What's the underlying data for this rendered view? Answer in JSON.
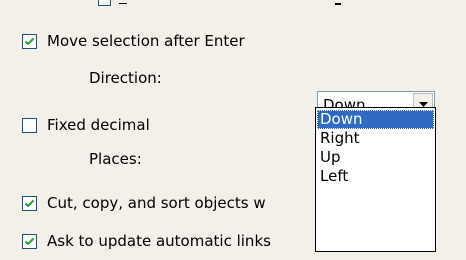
{
  "options": {
    "move_selection_after_enter": {
      "label": "Move selection after Enter",
      "checked": true
    },
    "direction": {
      "label": "Direction:",
      "value": "Down",
      "list": [
        "Down",
        "Right",
        "Up",
        "Left"
      ],
      "highlighted": "Down"
    },
    "fixed_decimal": {
      "label": "Fixed decimal",
      "checked": false
    },
    "places": {
      "label": "Places:"
    },
    "cut_copy_sort": {
      "label": "Cut, copy, and sort objects w",
      "checked": true
    },
    "ask_update_links": {
      "label": "Ask to update automatic links",
      "checked": true
    }
  },
  "colors": {
    "background": "#f2f0e9",
    "checkbox_border": "#1c5180",
    "checkmark": "#21a121",
    "highlight": "#316ac5"
  },
  "icons": {
    "check": "check-icon",
    "dropdown": "chevron-down-icon"
  }
}
